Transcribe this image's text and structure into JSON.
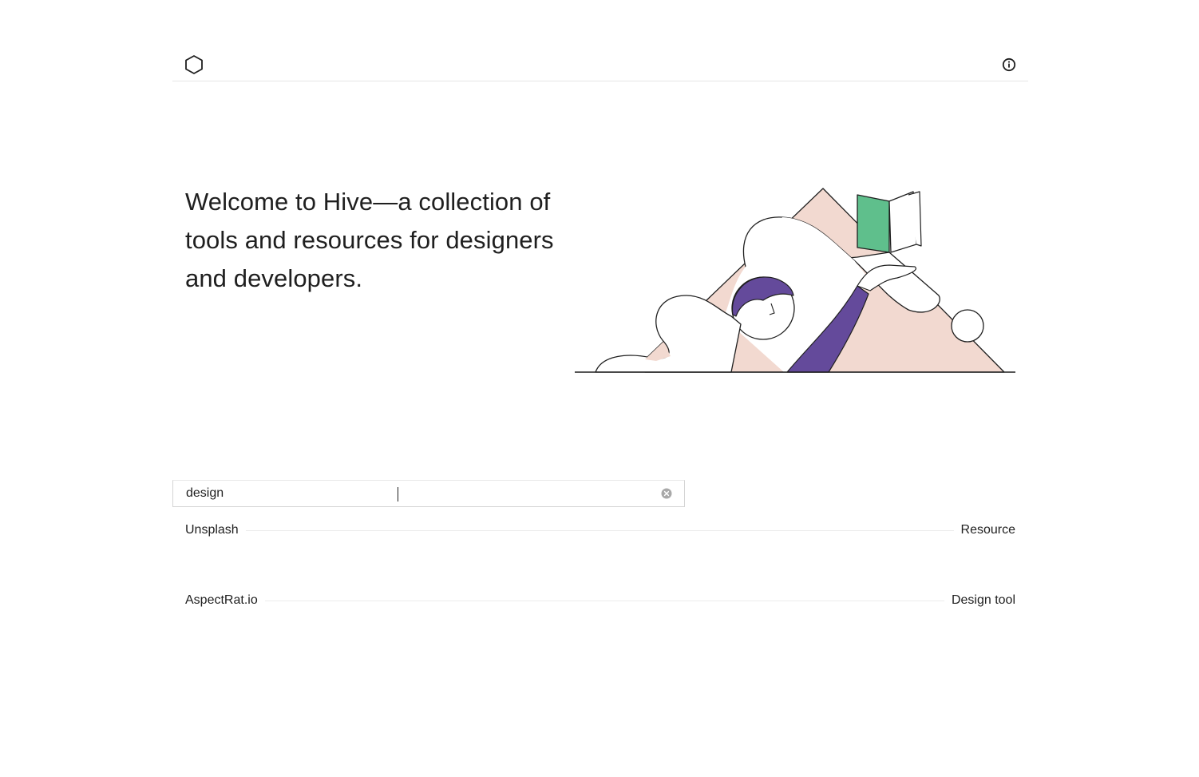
{
  "header": {
    "logo_icon": "hexagon-icon",
    "info_icon": "info-circle-icon"
  },
  "hero": {
    "headline": "Welcome to Hive—a collection of tools and resources for designers and developers.",
    "illustration": "person-reading-book-on-mountain-illustration",
    "colors": {
      "mountain": "#f2d9d0",
      "book_cover": "#5fbf8c",
      "accent": "#644a9b"
    }
  },
  "search": {
    "value": "design",
    "placeholder": "",
    "clear_icon": "clear-circle-icon"
  },
  "results": [
    {
      "name": "Unsplash",
      "type": "Resource"
    },
    {
      "name": "AspectRat.io",
      "type": "Design tool"
    }
  ]
}
